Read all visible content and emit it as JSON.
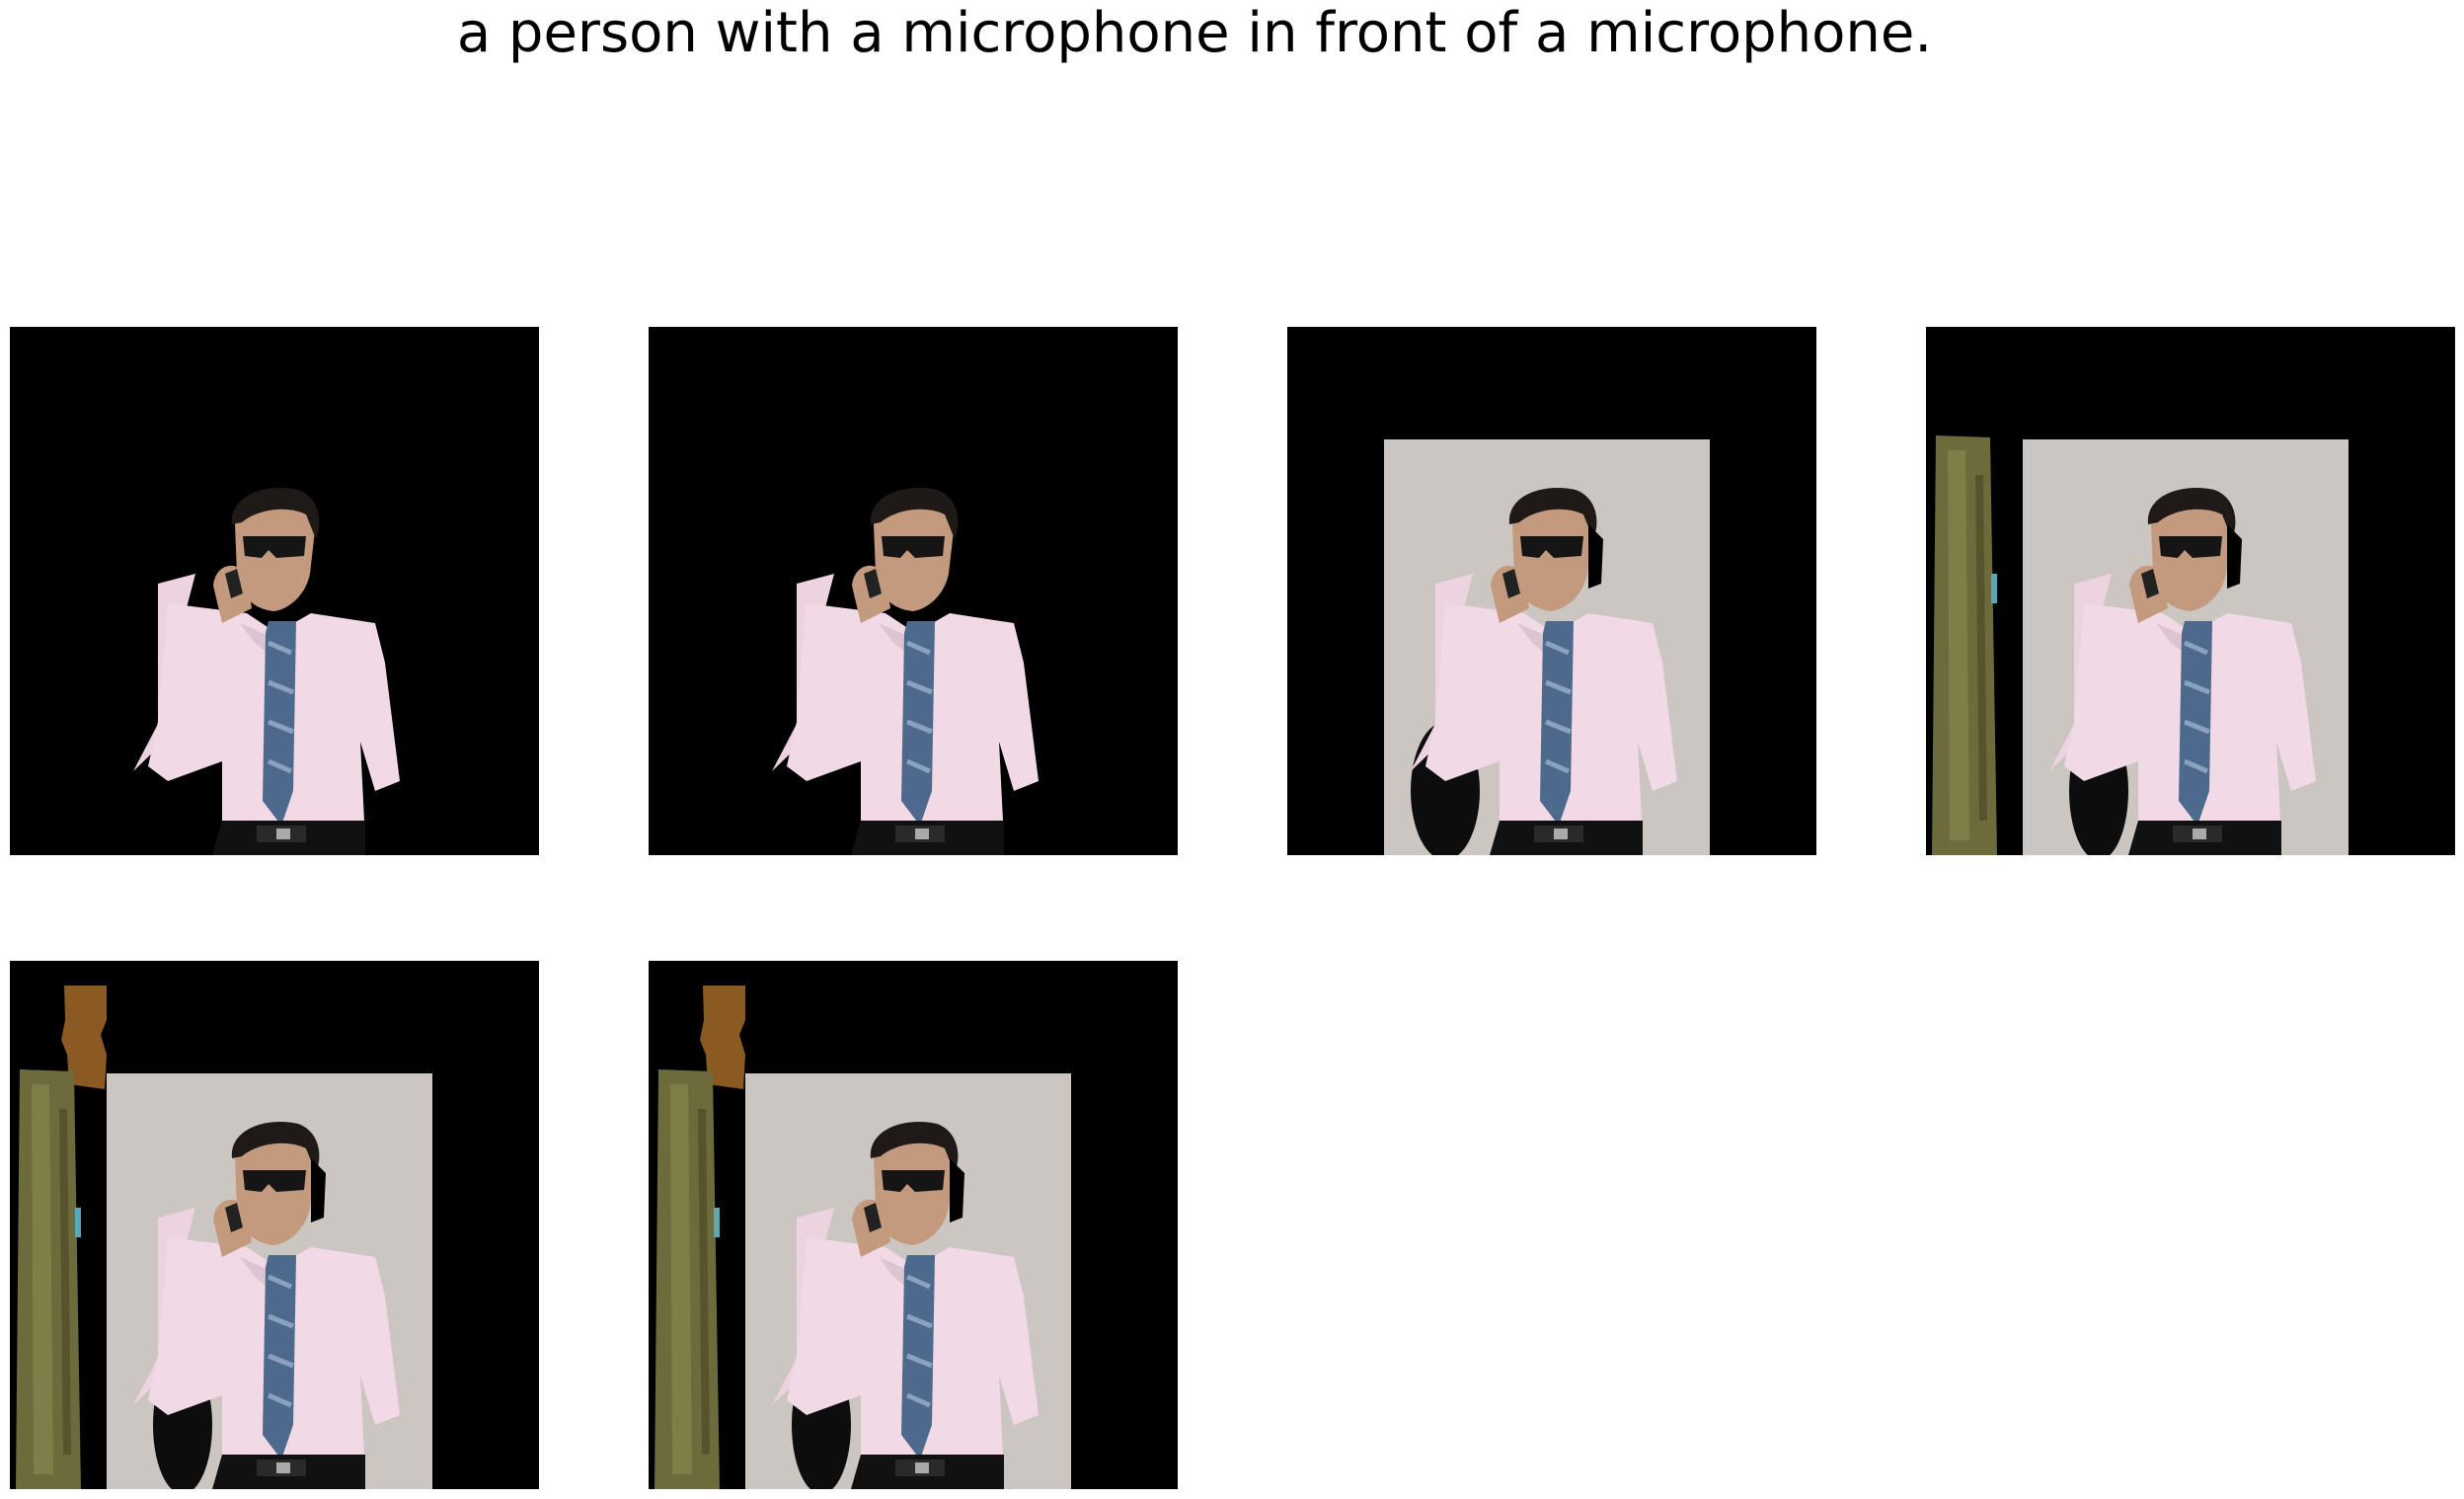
{
  "figure": {
    "title": "a person with a microphone in front of a microphone."
  },
  "panels": [
    {
      "id": "p1",
      "reveal": "person-only"
    },
    {
      "id": "p2",
      "reveal": "person-only"
    },
    {
      "id": "p3",
      "reveal": "person-and-wall"
    },
    {
      "id": "p4",
      "reveal": "person-wall-and-door"
    },
    {
      "id": "p5",
      "reveal": "person-wall-door-and-upper-frame"
    },
    {
      "id": "p6",
      "reveal": "person-wall-door-and-upper-frame"
    }
  ],
  "colors": {
    "mask": "#000000",
    "wall": "#cbc6c1",
    "shirt": "#f1d9e6",
    "tie": "#4d6a8c",
    "skin": "#c49a7e",
    "hair": "#1f1a17",
    "door": "#6c6b3b",
    "door_frame": "#8a5a22"
  }
}
